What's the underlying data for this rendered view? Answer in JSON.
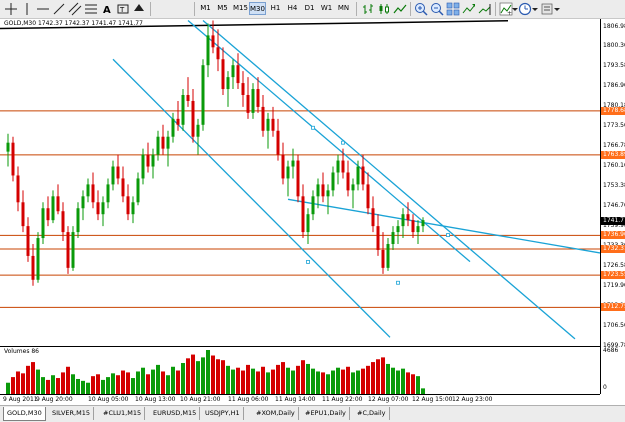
{
  "toolbar": {
    "timeframes": [
      "M1",
      "M5",
      "M15",
      "M30",
      "H1",
      "H4",
      "D1",
      "W1",
      "MN"
    ],
    "active_timeframe": "M30"
  },
  "chart_info": {
    "symbol_line": "GOLD,M30 1742.37 1742.37 1741.47 1741.77"
  },
  "price_axis": {
    "labels": [
      "1806.98",
      "1800.30",
      "1793.58",
      "1786.90",
      "1780.18",
      "1773.50",
      "1766.78",
      "1760.10",
      "1753.38",
      "1746.70",
      "1739.98",
      "1733.30",
      "1726.58",
      "1719.90",
      "1713.18",
      "1706.50",
      "1699.78"
    ],
    "tags": [
      {
        "text": "1778.68",
        "style": "red",
        "price": 1778.68
      },
      {
        "text": "1763.89",
        "style": "red",
        "price": 1763.89
      },
      {
        "text": "1741.77",
        "style": "cur",
        "price": 1741.77
      },
      {
        "text": "1736.90",
        "style": "red",
        "price": 1736.9
      },
      {
        "text": "1732.31",
        "style": "red",
        "price": 1732.31
      },
      {
        "text": "1723.55",
        "style": "red",
        "price": 1723.55
      },
      {
        "text": "1712.75",
        "style": "red",
        "price": 1712.75
      }
    ]
  },
  "volume": {
    "label": "Volumes 86",
    "axis_top": "4686",
    "axis_bottom": "0"
  },
  "time_axis": [
    "9 Aug 2011",
    "9 Aug 20:00",
    "10 Aug 05:00",
    "10 Aug 13:00",
    "10 Aug 21:00",
    "11 Aug 06:00",
    "11 Aug 14:00",
    "11 Aug 22:00",
    "12 Aug 07:00",
    "12 Aug 15:00",
    "12 Aug 23:00"
  ],
  "tabs": [
    "GOLD,M30",
    "SILVER,M15",
    "#CLU1,M15",
    "EURUSD,M15",
    "USDJPY,H1",
    "#XOM,Daily",
    "#EPU1,Daily",
    "#C,Daily"
  ],
  "active_tab": "GOLD,M30",
  "colors": {
    "bull": "#0a9a0a",
    "bear": "#d40000",
    "hline": "#c84300",
    "channel": "#1aa3d6",
    "trendline": "#000000"
  },
  "chart_data": {
    "type": "candlestick",
    "symbol": "GOLD",
    "timeframe": "M30",
    "y_range": [
      1699.78,
      1809.5
    ],
    "candles_ohlc": [
      [
        1765,
        1771,
        1760,
        1768
      ],
      [
        1768,
        1770,
        1755,
        1757
      ],
      [
        1757,
        1760,
        1745,
        1748
      ],
      [
        1748,
        1752,
        1738,
        1740
      ],
      [
        1740,
        1743,
        1728,
        1730
      ],
      [
        1730,
        1734,
        1720,
        1722
      ],
      [
        1722,
        1738,
        1721,
        1736
      ],
      [
        1736,
        1748,
        1734,
        1746
      ],
      [
        1746,
        1750,
        1740,
        1742
      ],
      [
        1742,
        1752,
        1741,
        1750
      ],
      [
        1750,
        1754,
        1744,
        1745
      ],
      [
        1745,
        1748,
        1735,
        1738
      ],
      [
        1738,
        1740,
        1724,
        1726
      ],
      [
        1726,
        1740,
        1725,
        1738
      ],
      [
        1738,
        1748,
        1736,
        1746
      ],
      [
        1746,
        1752,
        1742,
        1750
      ],
      [
        1750,
        1756,
        1748,
        1754
      ],
      [
        1754,
        1758,
        1746,
        1748
      ],
      [
        1748,
        1752,
        1742,
        1744
      ],
      [
        1744,
        1750,
        1740,
        1748
      ],
      [
        1748,
        1756,
        1746,
        1754
      ],
      [
        1754,
        1762,
        1752,
        1760
      ],
      [
        1760,
        1764,
        1754,
        1756
      ],
      [
        1756,
        1760,
        1748,
        1750
      ],
      [
        1750,
        1754,
        1742,
        1744
      ],
      [
        1744,
        1750,
        1741,
        1748
      ],
      [
        1748,
        1758,
        1747,
        1756
      ],
      [
        1756,
        1766,
        1754,
        1764
      ],
      [
        1764,
        1768,
        1758,
        1760
      ],
      [
        1760,
        1766,
        1756,
        1764
      ],
      [
        1764,
        1772,
        1762,
        1770
      ],
      [
        1770,
        1774,
        1764,
        1766
      ],
      [
        1766,
        1772,
        1760,
        1770
      ],
      [
        1770,
        1778,
        1768,
        1776
      ],
      [
        1776,
        1782,
        1772,
        1774
      ],
      [
        1774,
        1786,
        1772,
        1784
      ],
      [
        1784,
        1790,
        1780,
        1782
      ],
      [
        1782,
        1786,
        1768,
        1770
      ],
      [
        1770,
        1776,
        1764,
        1774
      ],
      [
        1774,
        1796,
        1772,
        1794
      ],
      [
        1794,
        1808,
        1790,
        1804
      ],
      [
        1804,
        1809,
        1798,
        1800
      ],
      [
        1800,
        1806,
        1792,
        1796
      ],
      [
        1796,
        1800,
        1784,
        1786
      ],
      [
        1786,
        1792,
        1780,
        1790
      ],
      [
        1790,
        1796,
        1786,
        1794
      ],
      [
        1794,
        1798,
        1786,
        1788
      ],
      [
        1788,
        1792,
        1780,
        1784
      ],
      [
        1784,
        1790,
        1776,
        1778
      ],
      [
        1778,
        1788,
        1776,
        1786
      ],
      [
        1786,
        1790,
        1778,
        1780
      ],
      [
        1780,
        1784,
        1770,
        1772
      ],
      [
        1772,
        1778,
        1766,
        1776
      ],
      [
        1776,
        1780,
        1770,
        1772
      ],
      [
        1772,
        1776,
        1762,
        1764
      ],
      [
        1764,
        1768,
        1754,
        1756
      ],
      [
        1756,
        1762,
        1750,
        1760
      ],
      [
        1760,
        1766,
        1756,
        1762
      ],
      [
        1762,
        1764,
        1748,
        1750
      ],
      [
        1750,
        1754,
        1736,
        1738
      ],
      [
        1738,
        1746,
        1734,
        1744
      ],
      [
        1744,
        1752,
        1742,
        1750
      ],
      [
        1750,
        1756,
        1746,
        1754
      ],
      [
        1754,
        1758,
        1748,
        1750
      ],
      [
        1750,
        1754,
        1744,
        1752
      ],
      [
        1752,
        1760,
        1750,
        1758
      ],
      [
        1758,
        1764,
        1754,
        1762
      ],
      [
        1762,
        1766,
        1756,
        1758
      ],
      [
        1758,
        1762,
        1750,
        1752
      ],
      [
        1752,
        1756,
        1746,
        1754
      ],
      [
        1754,
        1762,
        1752,
        1760
      ],
      [
        1760,
        1764,
        1752,
        1754
      ],
      [
        1754,
        1758,
        1744,
        1746
      ],
      [
        1746,
        1750,
        1738,
        1740
      ],
      [
        1740,
        1744,
        1730,
        1732
      ],
      [
        1732,
        1738,
        1724,
        1726
      ],
      [
        1726,
        1736,
        1725,
        1734
      ],
      [
        1734,
        1740,
        1732,
        1738
      ],
      [
        1738,
        1742,
        1734,
        1740
      ],
      [
        1740,
        1746,
        1736,
        1744
      ],
      [
        1744,
        1748,
        1740,
        1742
      ],
      [
        1742,
        1744,
        1736,
        1738
      ],
      [
        1738,
        1742,
        1734,
        1740
      ],
      [
        1740,
        1743,
        1738,
        1742
      ]
    ],
    "volumes": [
      1200,
      1800,
      2400,
      2200,
      3000,
      3400,
      2600,
      1800,
      1500,
      2000,
      1700,
      2300,
      2900,
      2100,
      1600,
      1400,
      1200,
      1900,
      2100,
      1500,
      1800,
      2200,
      2000,
      2500,
      2300,
      1700,
      2400,
      2800,
      2100,
      2600,
      3100,
      2400,
      2000,
      2900,
      2500,
      3300,
      3800,
      4200,
      3500,
      3900,
      4686,
      4100,
      3700,
      3600,
      3000,
      2600,
      2800,
      2500,
      3100,
      2700,
      2400,
      2900,
      2300,
      2600,
      3100,
      3400,
      2800,
      2500,
      3000,
      3600,
      3200,
      2700,
      2400,
      2300,
      2100,
      2500,
      2800,
      2600,
      2900,
      2300,
      2500,
      2700,
      3000,
      3400,
      3700,
      3900,
      3200,
      2800,
      2500,
      2700,
      2300,
      2100,
      1900,
      600
    ],
    "horizontal_levels": [
      1778.68,
      1763.89,
      1736.9,
      1732.31,
      1723.55,
      1712.75
    ],
    "channels": [
      [
        [
          1767,
          1796
        ],
        [
          1759,
          1700
        ]
      ],
      [
        [
          1783,
          1809
        ],
        [
          1757,
          1700
        ]
      ],
      [
        [
          1797,
          1809
        ],
        [
          1760,
          1700
        ]
      ],
      [
        [
          1743,
          1800
        ]
      ]
    ]
  }
}
